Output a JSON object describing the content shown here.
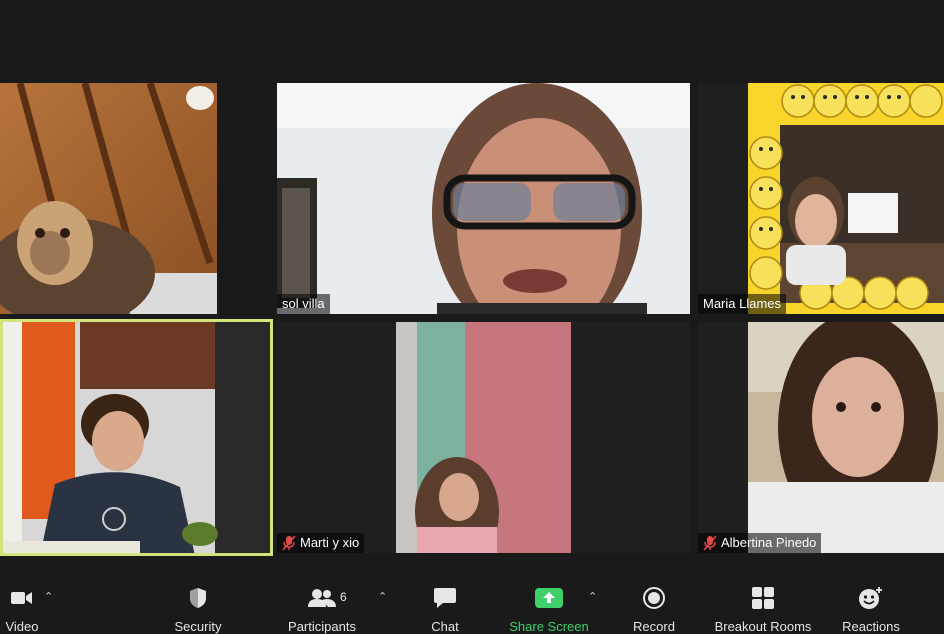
{
  "window": {
    "background": "#1a1a1a"
  },
  "participants": [
    {
      "id": "t1",
      "name": "",
      "muted": false,
      "description": "monkey"
    },
    {
      "id": "t2",
      "name": "sol villa",
      "muted": false
    },
    {
      "id": "t3",
      "name": "Maria Llames",
      "muted": false
    },
    {
      "id": "t4",
      "name": "",
      "muted": false,
      "active_speaker": true
    },
    {
      "id": "t5",
      "name": "Marti y xio",
      "muted": true
    },
    {
      "id": "t6",
      "name": "Albertina Pinedo",
      "muted": true
    }
  ],
  "toolbar": {
    "video_label": "Video",
    "security_label": "Security",
    "participants_label": "Participants",
    "participants_count": "6",
    "chat_label": "Chat",
    "share_label": "Share Screen",
    "record_label": "Record",
    "breakout_label": "Breakout Rooms",
    "reactions_label": "Reactions",
    "share_color": "#3dd06b",
    "active_speaker_color": "#d2e37a"
  }
}
